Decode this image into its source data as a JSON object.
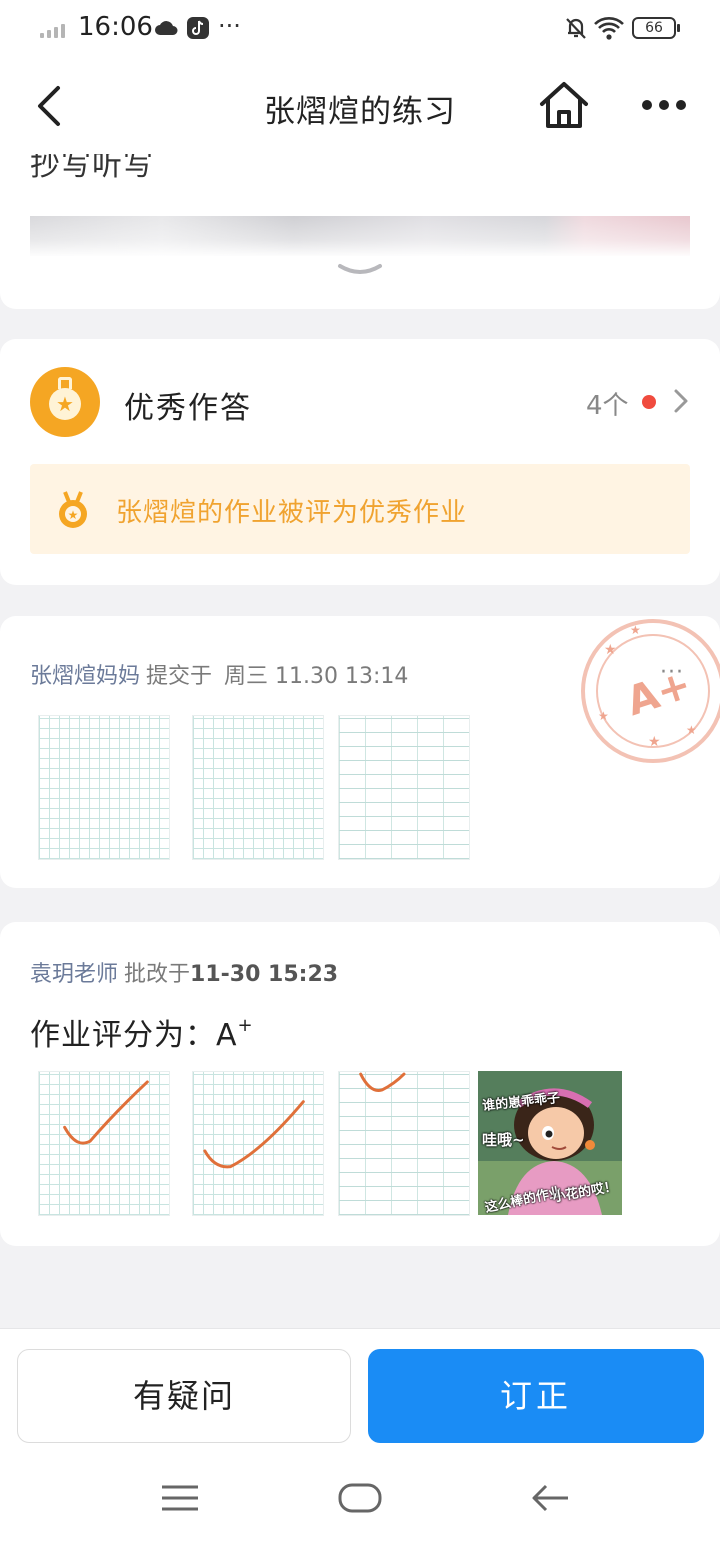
{
  "status_bar": {
    "time": "16:06",
    "battery": "66",
    "more": "···"
  },
  "nav": {
    "title": "张熠煊的练习"
  },
  "assignment": {
    "partial_title": "抄写听写"
  },
  "excellent": {
    "title": "优秀作答",
    "count": "4个",
    "notice": "张熠煊的作业被评为优秀作业"
  },
  "submission": {
    "parent": "张熠煊妈妈",
    "action": "提交于",
    "time": "周三 11.30 13:14",
    "stamp_grade": "A+",
    "more": "···"
  },
  "grading": {
    "teacher": "袁玥老师",
    "action": "批改于",
    "time": "11-30 15:23",
    "score_label": "作业评分为：",
    "score_grade": "A",
    "score_plus": "+",
    "meme_texts": [
      "谁的崽乖乖子",
      "哇哦~",
      "这么棒的作业",
      "小花的哎！"
    ]
  },
  "actions": {
    "question": "有疑问",
    "correct": "订正"
  },
  "colors": {
    "accent": "#1a8cf5",
    "gold": "#f5a623",
    "notice_bg": "#fff4e3",
    "red_dot": "#f04b3e",
    "check_mark": "#e0703a"
  }
}
